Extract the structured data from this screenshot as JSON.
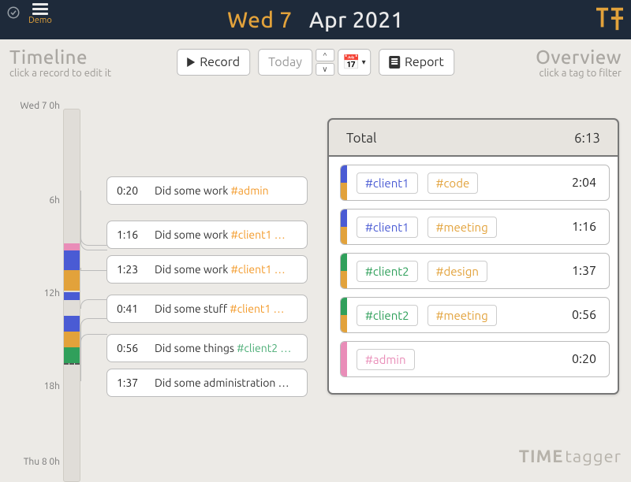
{
  "header": {
    "demo_label": "Demo",
    "date_day": "Wed 7",
    "date_rest": "Apr 2021"
  },
  "panels": {
    "timeline_title": "Timeline",
    "timeline_sub": "click a record to edit it",
    "overview_title": "Overview",
    "overview_sub": "click a tag to filter"
  },
  "toolbar": {
    "record": "Record",
    "today": "Today",
    "report": "Report"
  },
  "axis": {
    "t0": "Wed 7 0h",
    "t6": "6h",
    "t12": "12h",
    "t18": "18h",
    "t24": "Thu 8 0h"
  },
  "records": [
    {
      "dur": "0:20",
      "desc": "Did some work ",
      "tag": "#admin",
      "tag_class": "tag"
    },
    {
      "dur": "1:16",
      "desc": "Did some work ",
      "tag": "#client1 …",
      "tag_class": "tag"
    },
    {
      "dur": "1:23",
      "desc": "Did some work ",
      "tag": "#client1 …",
      "tag_class": "tag"
    },
    {
      "dur": "0:41",
      "desc": "Did some stuff ",
      "tag": "#client1 …",
      "tag_class": "tag"
    },
    {
      "dur": "0:56",
      "desc": "Did some things ",
      "tag": "#client2 …",
      "tag_class": "tag green"
    },
    {
      "dur": "1:37",
      "desc": "Did some administration …",
      "tag": "",
      "tag_class": "tag"
    }
  ],
  "overview": {
    "total_label": "Total",
    "total_value": "6:13",
    "rows": [
      {
        "stripes": [
          "#4a5bd4",
          "#e2a23b"
        ],
        "chips": [
          {
            "t": "#client1",
            "c": "blue"
          },
          {
            "t": "#code",
            "c": "orange"
          }
        ],
        "dur": "2:04"
      },
      {
        "stripes": [
          "#4a5bd4",
          "#e2a23b"
        ],
        "chips": [
          {
            "t": "#client1",
            "c": "blue"
          },
          {
            "t": "#meeting",
            "c": "orange"
          }
        ],
        "dur": "1:16"
      },
      {
        "stripes": [
          "#30a05b",
          "#e2a23b"
        ],
        "chips": [
          {
            "t": "#client2",
            "c": "green"
          },
          {
            "t": "#design",
            "c": "orange"
          }
        ],
        "dur": "1:37"
      },
      {
        "stripes": [
          "#30a05b",
          "#e2a23b"
        ],
        "chips": [
          {
            "t": "#client2",
            "c": "green"
          },
          {
            "t": "#meeting",
            "c": "orange"
          }
        ],
        "dur": "0:56"
      },
      {
        "stripes": [
          "#e98db8"
        ],
        "chips": [
          {
            "t": "#admin",
            "c": "pink"
          }
        ],
        "dur": "0:20"
      }
    ]
  },
  "footer": {
    "brand_a": "TIME",
    "brand_b": "tagger"
  }
}
